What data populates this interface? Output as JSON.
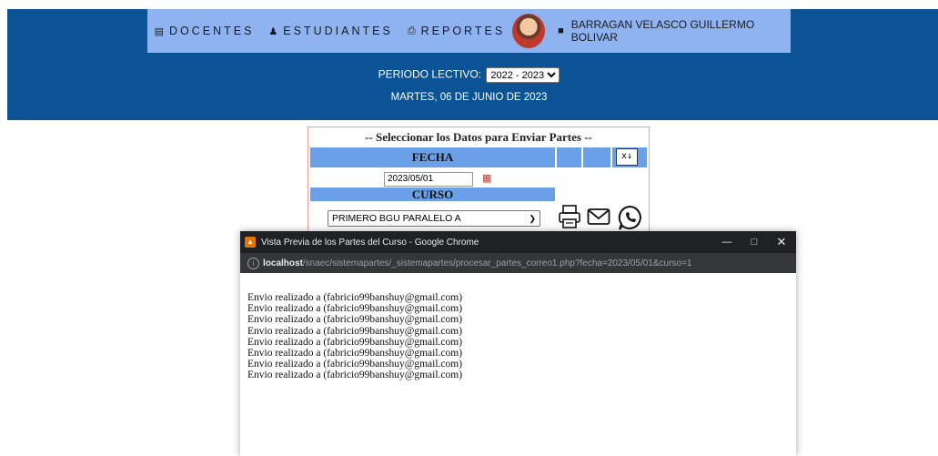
{
  "nav": {
    "docentes": "DOCENTES",
    "estudiantes": "ESTUDIANTES",
    "reportes": "REPORTES",
    "user_name": "BARRAGAN VELASCO GUILLERMO BOLIVAR"
  },
  "period": {
    "label": "PERIODO LECTIVO:",
    "value": "2022 - 2023"
  },
  "date_text": "MARTES, 06 DE JUNIO DE 2023",
  "form": {
    "title": "-- Seleccionar los Datos para Enviar Partes --",
    "fecha_label": "FECHA",
    "fecha_value": "2023/05/01",
    "curso_label": "CURSO",
    "curso_value": "PRIMERO BGU PARALELO A"
  },
  "popup": {
    "title": "Vista Previa de los Partes del Curso - Google Chrome",
    "url_host": "localhost",
    "url_path": "/snaec/sistemapartes/_sistemapartes/procesar_partes_correo1.php?fecha=2023/05/01&curso=1",
    "lines": [
      "Envio realizado a (fabricio99banshuy@gmail.com)",
      "Envio realizado a (fabricio99banshuy@gmail.com)",
      "Envio realizado a (fabricio99banshuy@gmail.com)",
      "Envio realizado a (fabricio99banshuy@gmail.com)",
      "Envio realizado a (fabricio99banshuy@gmail.com)",
      "Envio realizado a (fabricio99banshuy@gmail.com)",
      "Envio realizado a (fabricio99banshuy@gmail.com)",
      "Envio realizado a (fabricio99banshuy@gmail.com)"
    ]
  },
  "icons": {
    "docentes": "list-icon",
    "estudiantes": "user-icon",
    "reportes": "print-icon",
    "user": "briefcase-icon",
    "calendar": "calendar-icon",
    "excel": "excel-icon",
    "print": "printer-icon",
    "mail": "mail-icon",
    "whatsapp": "whatsapp-icon"
  },
  "colors": {
    "header": "#0b5394",
    "nav": "#8fb3f0",
    "table_header": "#6aa0e8",
    "panel_border": "#f0a0a0",
    "chrome_titlebar": "#202124"
  }
}
